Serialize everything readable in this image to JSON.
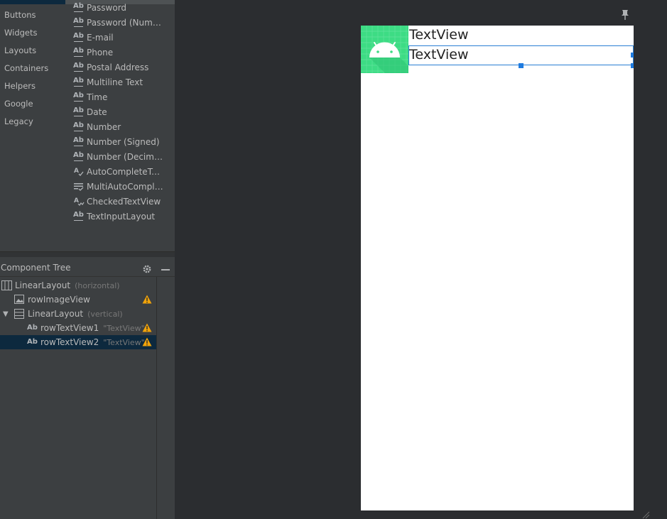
{
  "palette": {
    "categories": [
      "Buttons",
      "Widgets",
      "Layouts",
      "Containers",
      "Helpers",
      "Google",
      "Legacy"
    ],
    "items": [
      {
        "icon": "ab-text-icon",
        "label": "Password"
      },
      {
        "icon": "ab-text-icon",
        "label": "Password (Numer..."
      },
      {
        "icon": "ab-text-icon",
        "label": "E-mail"
      },
      {
        "icon": "ab-text-icon",
        "label": "Phone"
      },
      {
        "icon": "ab-text-icon",
        "label": "Postal Address"
      },
      {
        "icon": "ab-text-icon",
        "label": "Multiline Text"
      },
      {
        "icon": "ab-text-icon",
        "label": "Time"
      },
      {
        "icon": "ab-text-icon",
        "label": "Date"
      },
      {
        "icon": "ab-text-icon",
        "label": "Number"
      },
      {
        "icon": "ab-text-icon",
        "label": "Number (Signed)"
      },
      {
        "icon": "ab-text-icon",
        "label": "Number (Decimal)"
      },
      {
        "icon": "autocomplete-icon",
        "label": "AutoCompleteTex..."
      },
      {
        "icon": "multiautocomplete-icon",
        "label": "MultiAutoComple..."
      },
      {
        "icon": "checked-text-icon",
        "label": "CheckedTextView"
      },
      {
        "icon": "ab-text-icon",
        "label": "TextInputLayout"
      }
    ]
  },
  "component_tree": {
    "title": "Component Tree",
    "nodes": [
      {
        "label": "LinearLayout",
        "hint": "(horizontal)",
        "icon": "horizontal-layout-icon",
        "warning": false,
        "selected": false
      },
      {
        "label": "rowImageView",
        "hint": "",
        "icon": "image-icon",
        "warning": true,
        "selected": false
      },
      {
        "label": "LinearLayout",
        "hint": "(vertical)",
        "icon": "vertical-layout-icon",
        "warning": false,
        "selected": false,
        "expanded": true
      },
      {
        "label": "rowTextView1",
        "hint": "\"TextView\"",
        "icon": "ab-text-icon",
        "warning": true,
        "selected": false
      },
      {
        "label": "rowTextView2",
        "hint": "\"TextView\"",
        "icon": "ab-text-icon",
        "warning": true,
        "selected": true
      }
    ]
  },
  "design": {
    "text_view_1": "TextView",
    "text_view_2": "TextView"
  },
  "colors": {
    "selection": "#0d293e",
    "android_green": "#3ddc84",
    "warning": "#f0a30a",
    "handle_blue": "#1e7be0"
  }
}
